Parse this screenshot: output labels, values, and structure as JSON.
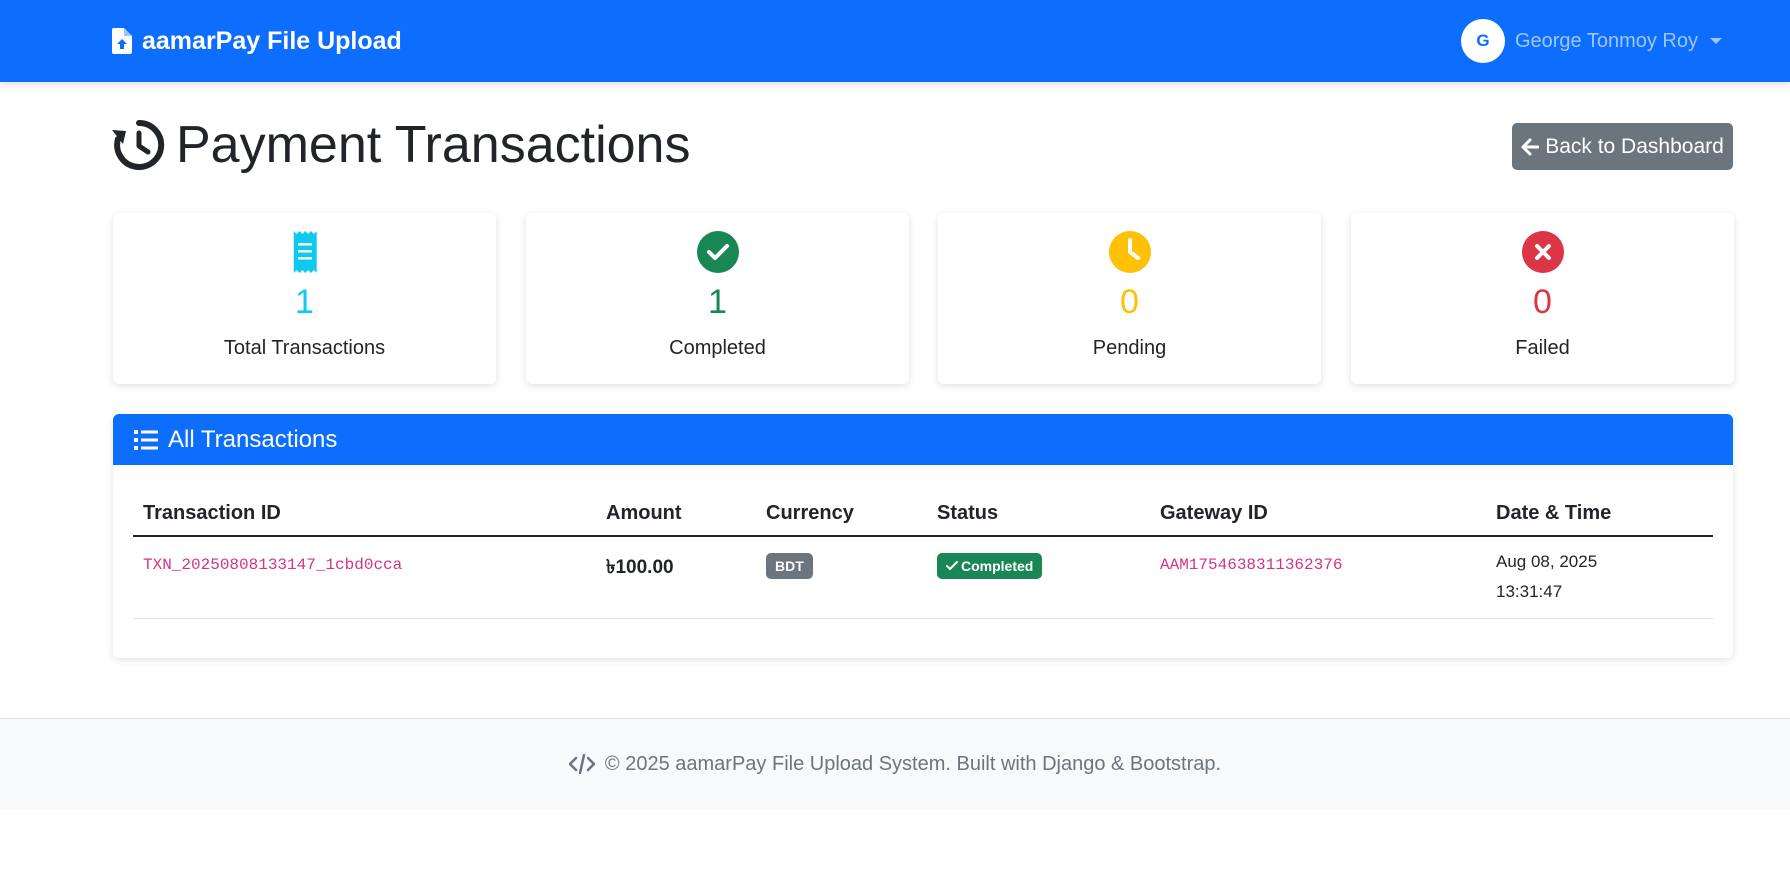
{
  "navbar": {
    "brand": "aamarPay File Upload",
    "brand_icon": "file-upload-icon",
    "user_initial": "G",
    "user_name": "George Tonmoy Roy"
  },
  "page": {
    "title": "Payment Transactions",
    "title_icon": "history-icon",
    "back_button": "Back to Dashboard"
  },
  "stats": [
    {
      "icon": "receipt-icon",
      "value": "1",
      "label": "Total Transactions",
      "color": "#0dcaf0"
    },
    {
      "icon": "check-circle-icon",
      "value": "1",
      "label": "Completed",
      "color": "#198754"
    },
    {
      "icon": "clock-icon",
      "value": "0",
      "label": "Pending",
      "color": "#ffc107"
    },
    {
      "icon": "x-circle-icon",
      "value": "0",
      "label": "Failed",
      "color": "#dc3545"
    }
  ],
  "transactions": {
    "title": "All Transactions",
    "columns": [
      "Transaction ID",
      "Amount",
      "Currency",
      "Status",
      "Gateway ID",
      "Date & Time"
    ],
    "rows": [
      {
        "transaction_id": "TXN_20250808133147_1cbd0cca",
        "amount": "৳100.00",
        "currency": "BDT",
        "status": "Completed",
        "gateway_id": "AAM1754638311362376",
        "date": "Aug 08, 2025",
        "time": "13:31:47"
      }
    ]
  },
  "footer": {
    "text": "© 2025 aamarPay File Upload System. Built with Django & Bootstrap."
  },
  "colors": {
    "primary": "#0d6efd",
    "secondary": "#6c757d",
    "success": "#198754",
    "code": "#d63384"
  }
}
